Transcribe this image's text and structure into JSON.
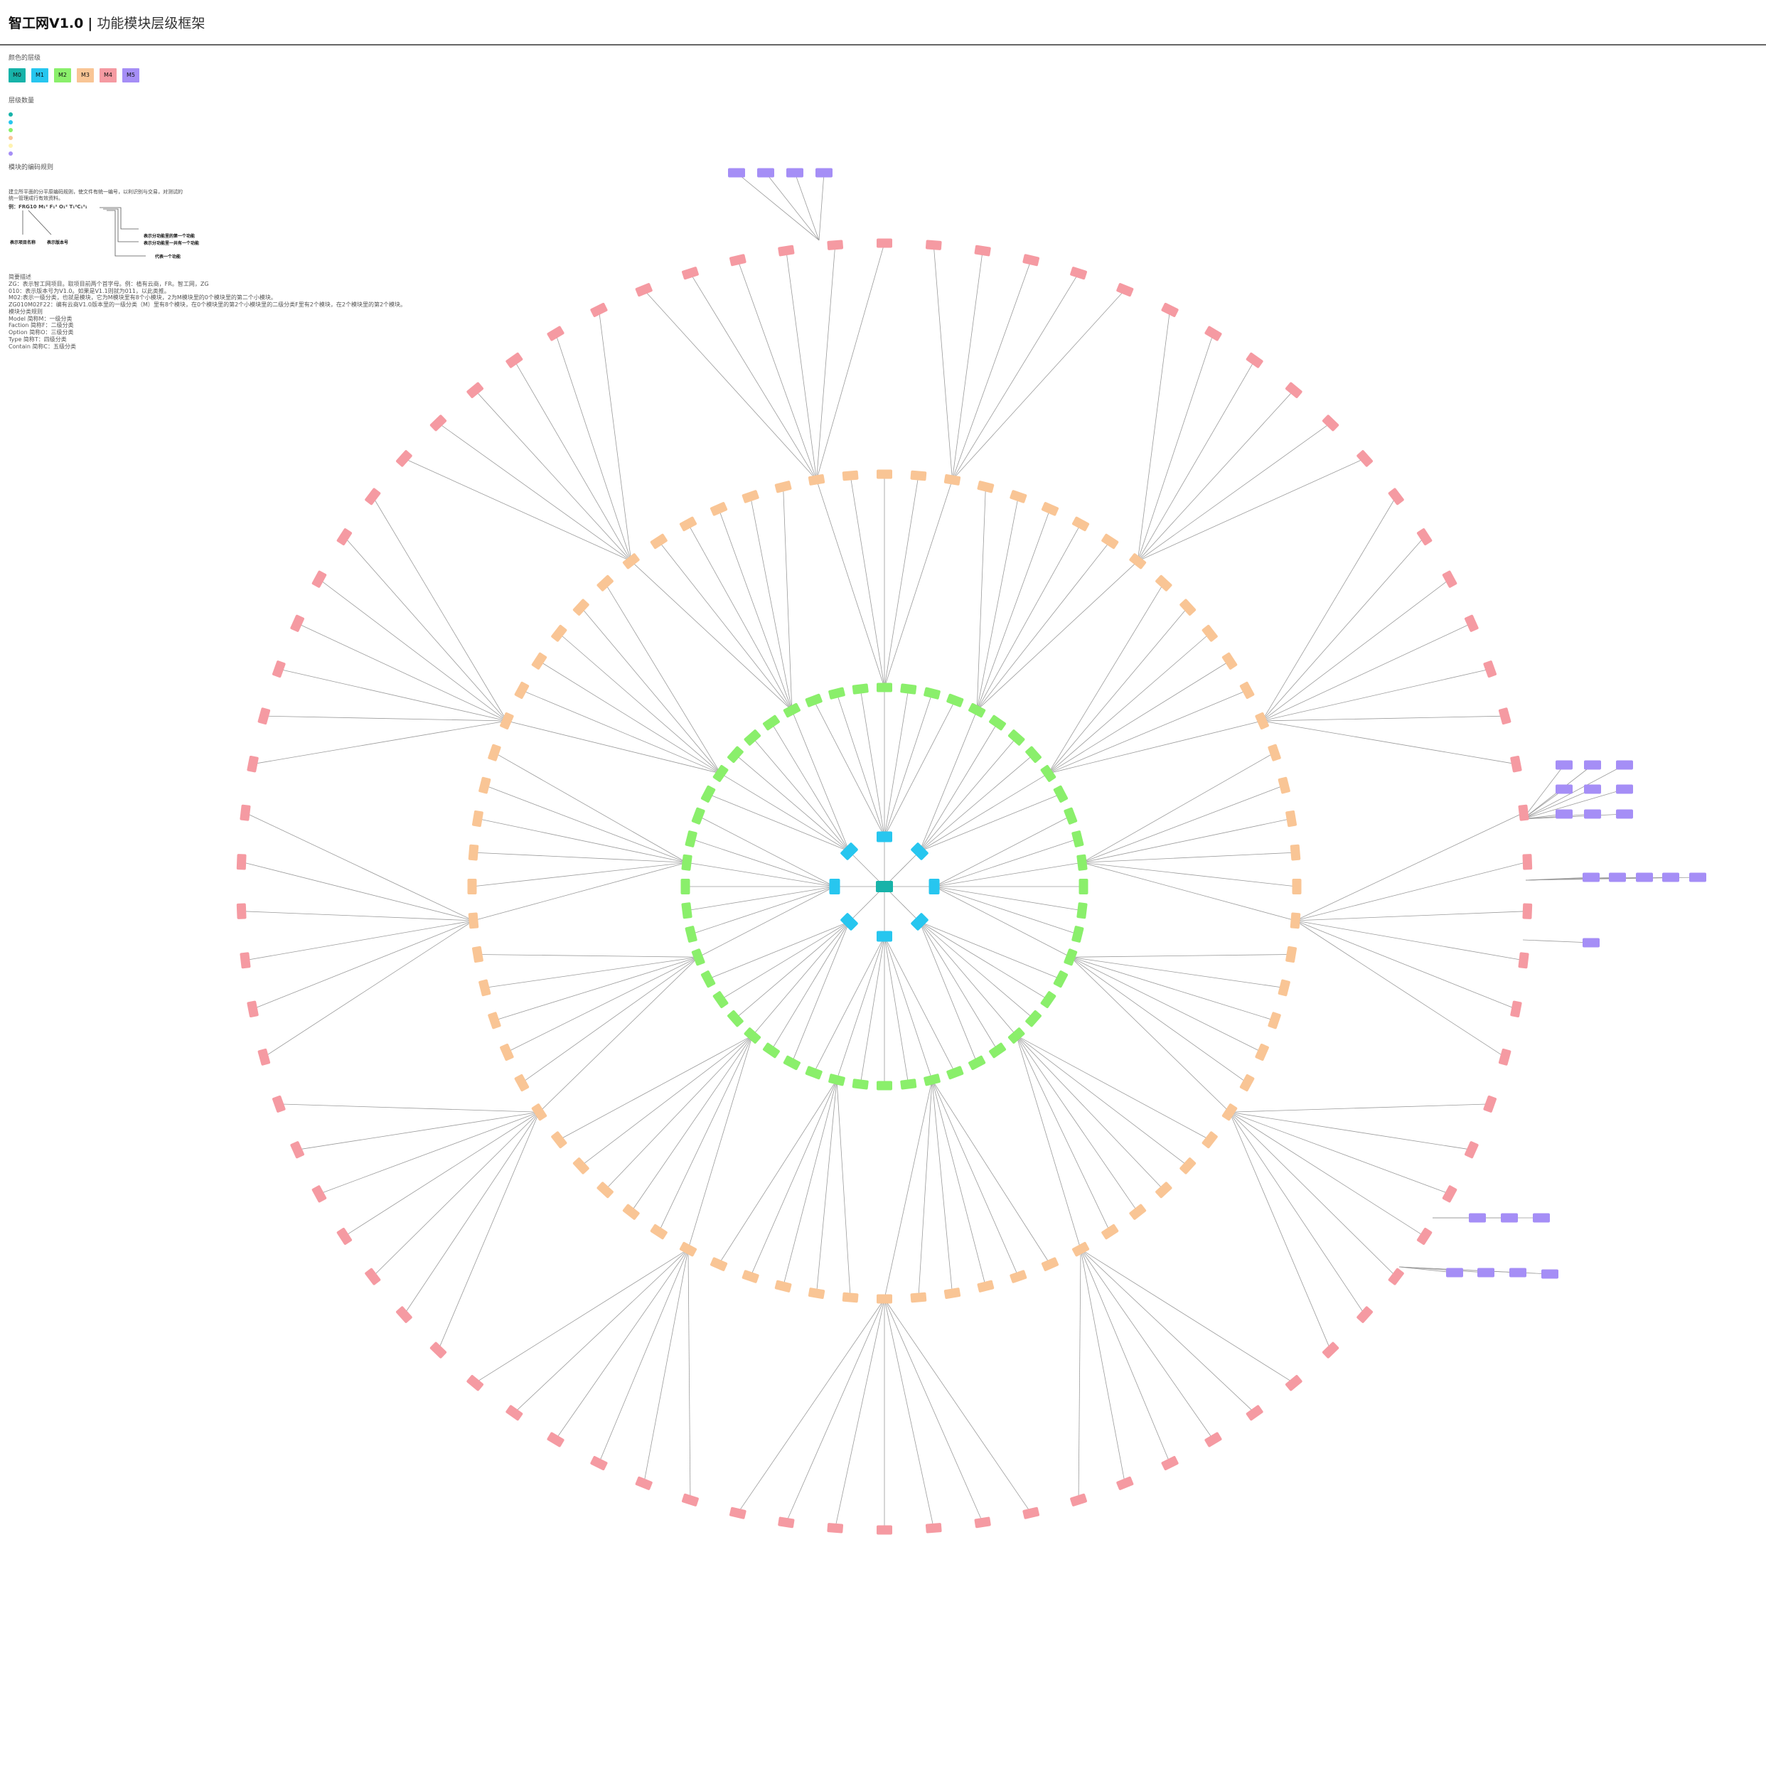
{
  "header": {
    "title": "智工网V1.0",
    "separator": "|",
    "subtitle": "功能模块层级框架"
  },
  "color_legend": {
    "title": "颜色的层级",
    "items": [
      {
        "code": "M0",
        "color": "#17b3a9"
      },
      {
        "code": "M1",
        "color": "#27c6ef"
      },
      {
        "code": "M2",
        "color": "#8aef6b"
      },
      {
        "code": "M3",
        "color": "#f9c595"
      },
      {
        "code": "M4",
        "color": "#f59aa2"
      },
      {
        "code": "M5",
        "color": "#a58ef6"
      }
    ]
  },
  "level_count": {
    "title": "层级数量"
  },
  "encoding": {
    "title": "模块的编码规则",
    "line1": "建立所平面的分平原编码规则，使文件有统一编号，以利识别与交易，对测试的",
    "line2": "统一管理成行有效资料。",
    "example": "例：FRG10 M₁² F₁² O₁² T₁²C₁²₁",
    "label_project": "表示项目名称",
    "label_version": "表示版本号",
    "label_a": "表示分功能里的第一个功能",
    "label_b": "表示分功能里一共有一个功能",
    "label_c": "代表一个功能"
  },
  "notes": {
    "title": "简要描述",
    "lines": [
      "ZG：表示智工网项目。取项目前两个首字母。例：植有云商，FR。智工网，ZG",
      "010：表示版本号为V1.0。如果是V1.1则就为011，以此类推。",
      "M02:表示一级分类，也就是模块，它为M模块里有8个小模块，2为M模块里的0个模块里的第二个小模块。",
      "ZG010M02F22：编有云商V1.0版本里的一级分类（M）里有8个模块，在0个模块里的第2个小模块里的二级分类F里有2个模块，在2个模块里的第2个模块。",
      "模块分类规则",
      "Model   简称M：一级分类",
      "Faction   简称F：二级分类",
      "Option   简称O：三级分类",
      "Type     简称T：四级分类",
      "Contain   简称C：五级分类"
    ]
  }
}
